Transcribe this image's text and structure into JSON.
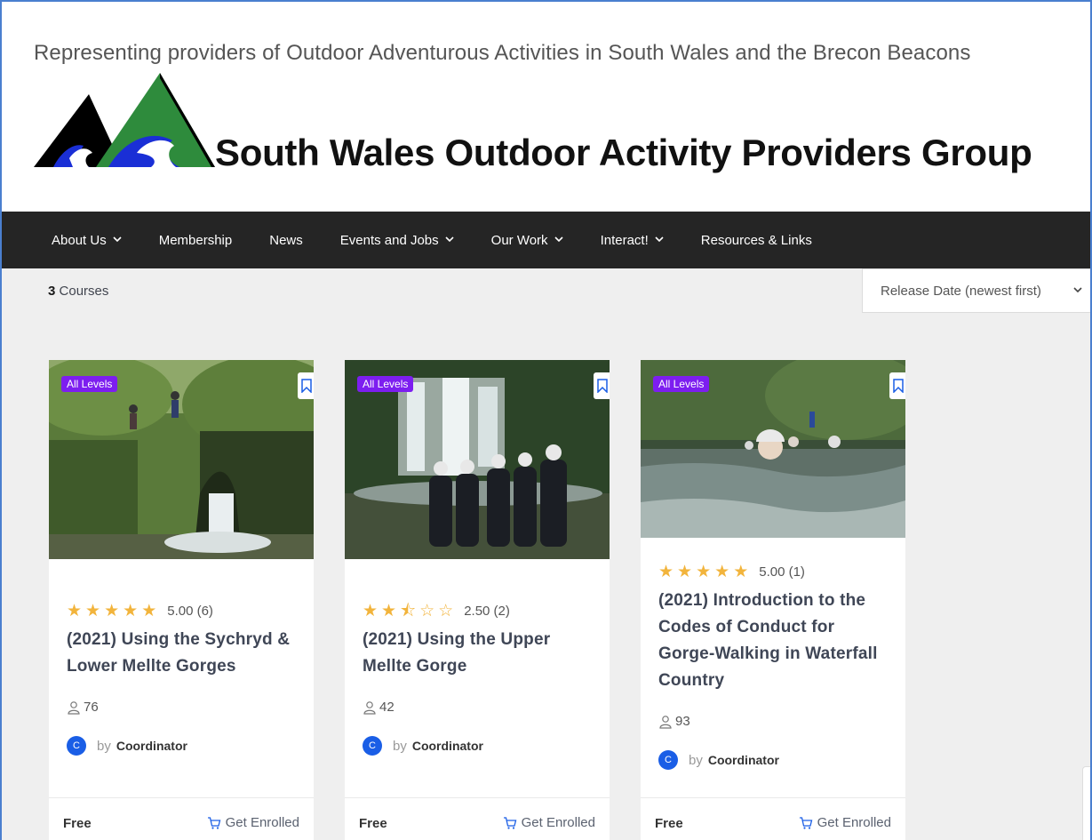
{
  "header": {
    "tagline": "Representing providers of Outdoor Adventurous Activities in South Wales and the Brecon Beacons",
    "site_title": "South Wales Outdoor Activity Providers Group",
    "logo_colors": {
      "black": "#000000",
      "green": "#2e8b3c",
      "blue": "#1a2fd6"
    }
  },
  "nav": {
    "items": [
      {
        "label": "About Us",
        "has_dropdown": true
      },
      {
        "label": "Membership",
        "has_dropdown": false
      },
      {
        "label": "News",
        "has_dropdown": false
      },
      {
        "label": "Events and Jobs",
        "has_dropdown": true
      },
      {
        "label": "Our Work",
        "has_dropdown": true
      },
      {
        "label": "Interact!",
        "has_dropdown": true
      },
      {
        "label": "Resources & Links",
        "has_dropdown": false
      }
    ]
  },
  "listing": {
    "count": "3",
    "count_label": "Courses",
    "sort_selected": "Release Date (newest first)"
  },
  "courses": [
    {
      "level": "All Levels",
      "rating": 5.0,
      "rating_text": "5.00 (6)",
      "title": "(2021) Using the Sychryd & Lower Mellte Gorges",
      "enrolled": "76",
      "author_initial": "C",
      "by": "by",
      "author": "Coordinator",
      "price": "Free",
      "cta": "Get Enrolled"
    },
    {
      "level": "All Levels",
      "rating": 2.5,
      "rating_text": "2.50 (2)",
      "title": "(2021) Using the Upper Mellte Gorge",
      "enrolled": "42",
      "author_initial": "C",
      "by": "by",
      "author": "Coordinator",
      "price": "Free",
      "cta": "Get Enrolled"
    },
    {
      "level": "All Levels",
      "rating": 5.0,
      "rating_text": "5.00 (1)",
      "title": "(2021) Introduction to the Codes of Conduct for Gorge-Walking in Waterfall Country",
      "enrolled": "93",
      "author_initial": "C",
      "by": "by",
      "author": "Coordinator",
      "price": "Free",
      "cta": "Get Enrolled"
    }
  ],
  "colors": {
    "nav_bg": "#252525",
    "badge": "#7d1ef0",
    "star": "#f2b43c",
    "avatar": "#1a5ee6",
    "content_bg": "#efefef"
  }
}
